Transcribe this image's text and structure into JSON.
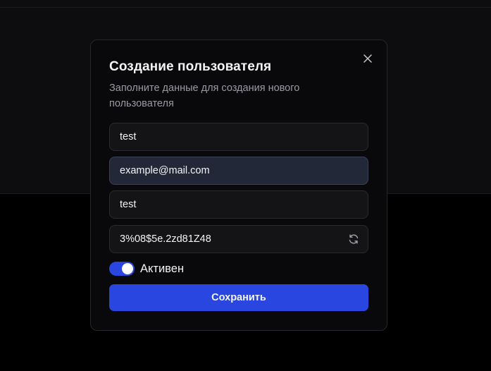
{
  "dialog": {
    "title": "Создание пользователя",
    "description": "Заполните данные для создания нового пользователя",
    "close_icon": "close-icon"
  },
  "form": {
    "username": {
      "value": "test"
    },
    "email": {
      "value": "example@mail.com"
    },
    "name": {
      "value": "test"
    },
    "password": {
      "value": "3%08$5e.2zd81Z48",
      "regenerate_icon": "refresh-icon"
    },
    "active": {
      "label": "Активен",
      "checked": true
    },
    "submit_label": "Сохранить"
  },
  "colors": {
    "accent": "#2947e0",
    "modal_background": "#09090b",
    "focused_field": "#222838"
  }
}
